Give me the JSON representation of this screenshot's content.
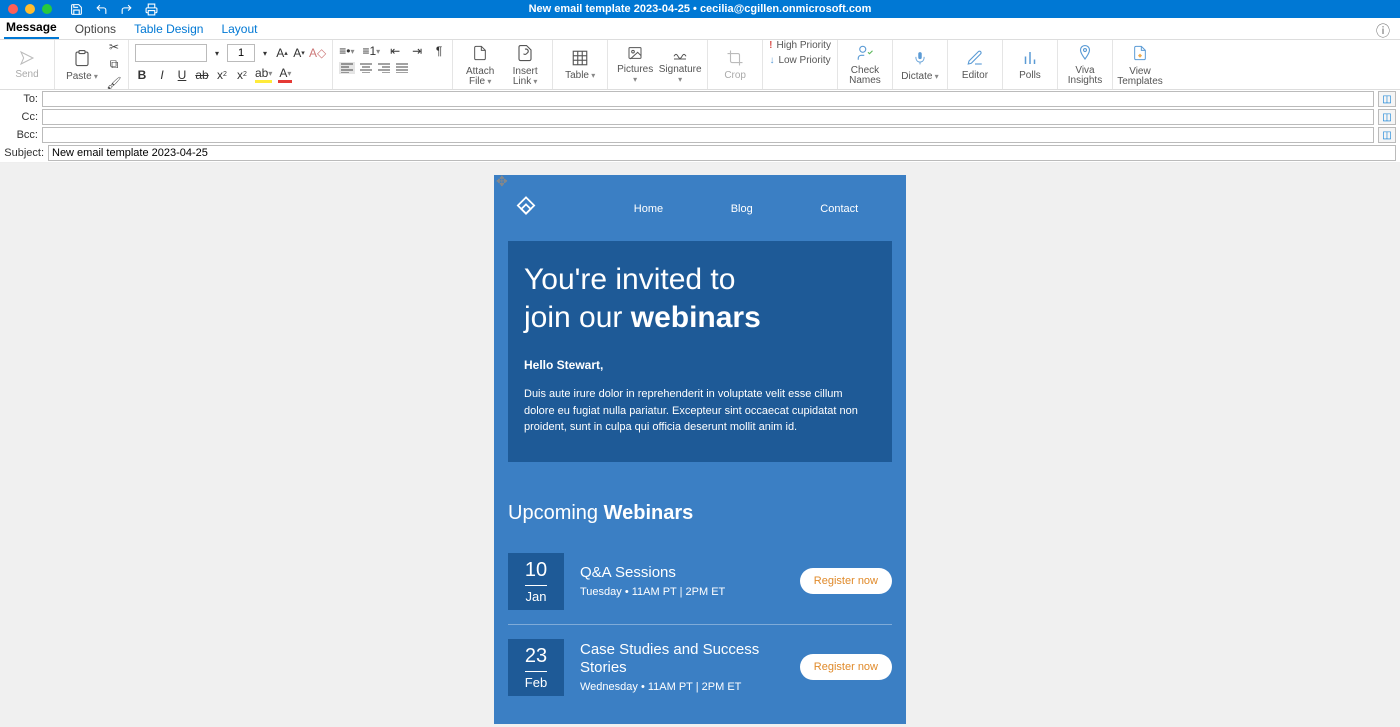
{
  "title": "New email template 2023-04-25 • cecilia@cgillen.onmicrosoft.com",
  "qat": {
    "save": "💾",
    "undo": "↩",
    "redo": "↪",
    "print": "🖶"
  },
  "tabs": {
    "message": "Message",
    "options": "Options",
    "table_design": "Table Design",
    "layout": "Layout"
  },
  "ribbon": {
    "send": "Send",
    "paste": "Paste",
    "font_size": "1",
    "attach_file": "Attach File",
    "insert_link": "Insert Link",
    "table": "Table",
    "pictures": "Pictures",
    "signature": "Signature",
    "crop": "Crop",
    "high": "High Priority",
    "low": "Low Priority",
    "check_names": "Check Names",
    "dictate": "Dictate",
    "editor": "Editor",
    "polls": "Polls",
    "viva": "Viva Insights",
    "templates": "View Templates"
  },
  "addr": {
    "to_label": "To:",
    "cc_label": "Cc:",
    "bcc_label": "Bcc:",
    "subject_label": "Subject:",
    "to": "",
    "cc": "",
    "bcc": "",
    "subject": "New email template 2023-04-25"
  },
  "email": {
    "nav": {
      "home": "Home",
      "blog": "Blog",
      "contact": "Contact"
    },
    "hero_line1": "You're invited to",
    "hero_line2a": "join our ",
    "hero_line2b": "webinars",
    "greeting": "Hello Stewart,",
    "paragraph": "Duis aute irure dolor in reprehenderit in voluptate velit esse cillum dolore eu fugiat nulla pariatur. Excepteur sint occaecat cupidatat non proident, sunt in culpa qui officia deserunt mollit anim id.",
    "upcoming_a": "Upcoming ",
    "upcoming_b": "Webinars",
    "events": [
      {
        "day": "10",
        "mon": "Jan",
        "title": "Q&A Sessions",
        "sub": "Tuesday • 11AM PT | 2PM ET",
        "btn": "Register now"
      },
      {
        "day": "23",
        "mon": "Feb",
        "title": "Case Studies and Success Stories",
        "sub": "Wednesday • 11AM PT | 2PM ET",
        "btn": "Register now"
      }
    ]
  }
}
